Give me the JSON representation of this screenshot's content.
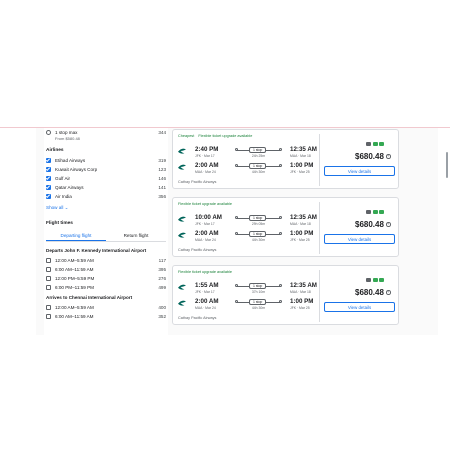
{
  "sidebar": {
    "stops_max": {
      "label": "1 stop max",
      "sub": "From $580.48",
      "count": "344"
    },
    "airlines_title": "Airlines",
    "airlines": [
      {
        "label": "Etihad Airways",
        "count": "319"
      },
      {
        "label": "Kuwait Airways Corp",
        "count": "123"
      },
      {
        "label": "Gulf Air",
        "count": "146"
      },
      {
        "label": "Qatar Airways",
        "count": "141"
      },
      {
        "label": "Air India",
        "count": "356"
      }
    ],
    "show_all": "Show all",
    "flight_times_title": "Flight times",
    "tabs": {
      "departing": "Departing flight",
      "return": "Return flight"
    },
    "depart_title": "Departs John F. Kennedy International Airport",
    "depart_times": [
      {
        "label": "12:00 AM–5:59 AM",
        "count": "117"
      },
      {
        "label": "6:00 AM–11:59 AM",
        "count": "395"
      },
      {
        "label": "12:00 PM–5:59 PM",
        "count": "276"
      },
      {
        "label": "6:00 PM–11:59 PM",
        "count": "499"
      }
    ],
    "arrive_title": "Arrives to Chennai International Airport",
    "arrive_times": [
      {
        "label": "12:00 AM–5:59 AM",
        "count": "400"
      },
      {
        "label": "6:00 AM–11:59 AM",
        "count": "352"
      }
    ]
  },
  "cards": [
    {
      "tag_cheapest": "Cheapest",
      "tag": "Flexible ticket upgrade available",
      "out": {
        "dep_time": "2:40 PM",
        "dep_info": "JFK · Mar 17",
        "stops": "1 stop",
        "duration": "24h 25m",
        "arr_time": "12:35 AM",
        "arr_info": "MAA · Mar 18"
      },
      "ret": {
        "dep_time": "2:00 AM",
        "dep_info": "MAA · Mar 24",
        "stops": "1 stop",
        "duration": "44h 30m",
        "arr_time": "1:00 PM",
        "arr_info": "JFK · Mar 25"
      },
      "carrier": "Cathay Pacific Airways",
      "price": "$680.48",
      "button": "View details"
    },
    {
      "tag_cheapest": "",
      "tag": "Flexible ticket upgrade available",
      "out": {
        "dep_time": "10:00 AM",
        "dep_info": "JFK · Mar 17",
        "stops": "1 stop",
        "duration": "29h 05m",
        "arr_time": "12:35 AM",
        "arr_info": "MAA · Mar 18"
      },
      "ret": {
        "dep_time": "2:00 AM",
        "dep_info": "MAA · Mar 24",
        "stops": "1 stop",
        "duration": "44h 30m",
        "arr_time": "1:00 PM",
        "arr_info": "JFK · Mar 25"
      },
      "carrier": "Cathay Pacific Airways",
      "price": "$680.48",
      "button": "View details"
    },
    {
      "tag_cheapest": "",
      "tag": "Flexible ticket upgrade available",
      "out": {
        "dep_time": "1:55 AM",
        "dep_info": "JFK · Mar 17",
        "stops": "1 stop",
        "duration": "37h 10m",
        "arr_time": "12:35 AM",
        "arr_info": "MAA · Mar 18"
      },
      "ret": {
        "dep_time": "2:00 AM",
        "dep_info": "MAA · Mar 24",
        "stops": "1 stop",
        "duration": "44h 30m",
        "arr_time": "1:00 PM",
        "arr_info": "JFK · Mar 25"
      },
      "carrier": "Cathay Pacific Airways",
      "price": "$680.48",
      "button": "View details"
    }
  ],
  "colors": {
    "accent": "#1a73e8",
    "tag_green": "#188038",
    "amenity_green": "#34a853"
  }
}
